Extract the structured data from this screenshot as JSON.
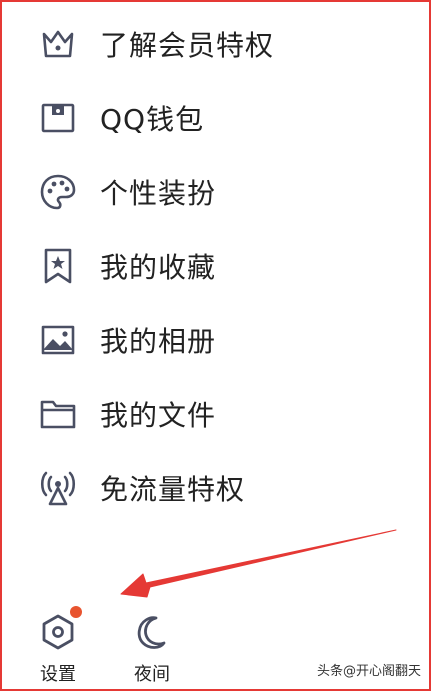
{
  "menu": {
    "items": [
      {
        "label": "了解会员特权",
        "icon": "crown-icon"
      },
      {
        "label": "QQ钱包",
        "icon": "wallet-icon"
      },
      {
        "label": "个性装扮",
        "icon": "palette-icon"
      },
      {
        "label": "我的收藏",
        "icon": "bookmark-star-icon"
      },
      {
        "label": "我的相册",
        "icon": "image-icon"
      },
      {
        "label": "我的文件",
        "icon": "folder-icon"
      },
      {
        "label": "免流量特权",
        "icon": "signal-tower-icon"
      }
    ]
  },
  "bottom": {
    "settings_label": "设置",
    "night_label": "夜间"
  },
  "colors": {
    "icon_stroke": "#4a4f63",
    "badge": "#e8542f",
    "arrow": "#e53935",
    "frame": "#e53935"
  },
  "watermark": "头条@开心阁翻天"
}
